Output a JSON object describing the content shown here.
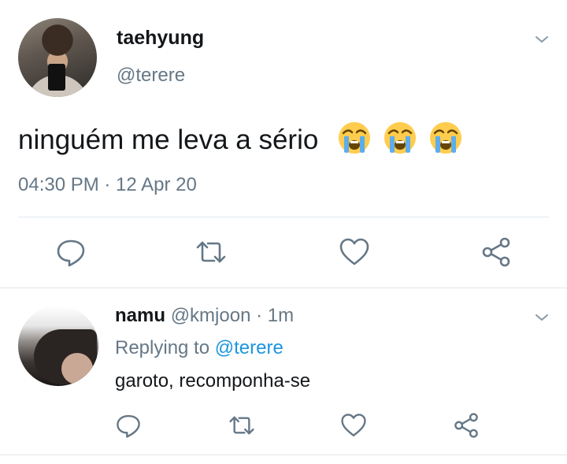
{
  "main_tweet": {
    "display_name": "taehyung",
    "handle": "@terere",
    "text": "ninguém me leva a sério",
    "emojis": [
      "loudly-crying-face",
      "loudly-crying-face",
      "loudly-crying-face"
    ],
    "timestamp": "04:30 PM · 12 Apr 20"
  },
  "reply_tweet": {
    "display_name": "namu",
    "handle": "@kmjoon",
    "separator": " · ",
    "time_ago": "1m",
    "replying_prefix": "Replying to",
    "replying_handle": "@terere",
    "text": "garoto, recomponha-se"
  },
  "icons": {
    "reply": "speech-bubble-icon",
    "retweet": "retweet-icon",
    "like": "heart-icon",
    "share": "share-icon",
    "menu": "chevron-down-icon"
  },
  "colors": {
    "text": "#14171a",
    "muted": "#657786",
    "link": "#1b95e0",
    "divider": "#e1e8ed",
    "icon": "#657786"
  }
}
